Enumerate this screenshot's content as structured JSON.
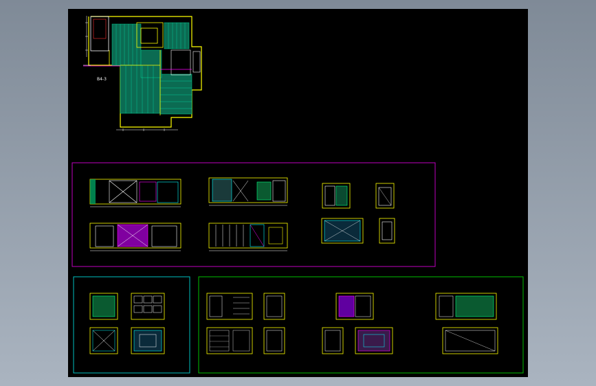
{
  "drawing": {
    "plan_label": "B4-3",
    "colors": {
      "background": "#000000",
      "frame_magenta": "#c000c0",
      "frame_cyan": "#00c0c0",
      "frame_green": "#00c000",
      "line_yellow": "#ffff00",
      "line_cyan": "#00ffff",
      "line_green": "#00c060",
      "line_magenta": "#ff00ff",
      "line_white": "#ffffff",
      "line_red": "#ff3030"
    }
  }
}
